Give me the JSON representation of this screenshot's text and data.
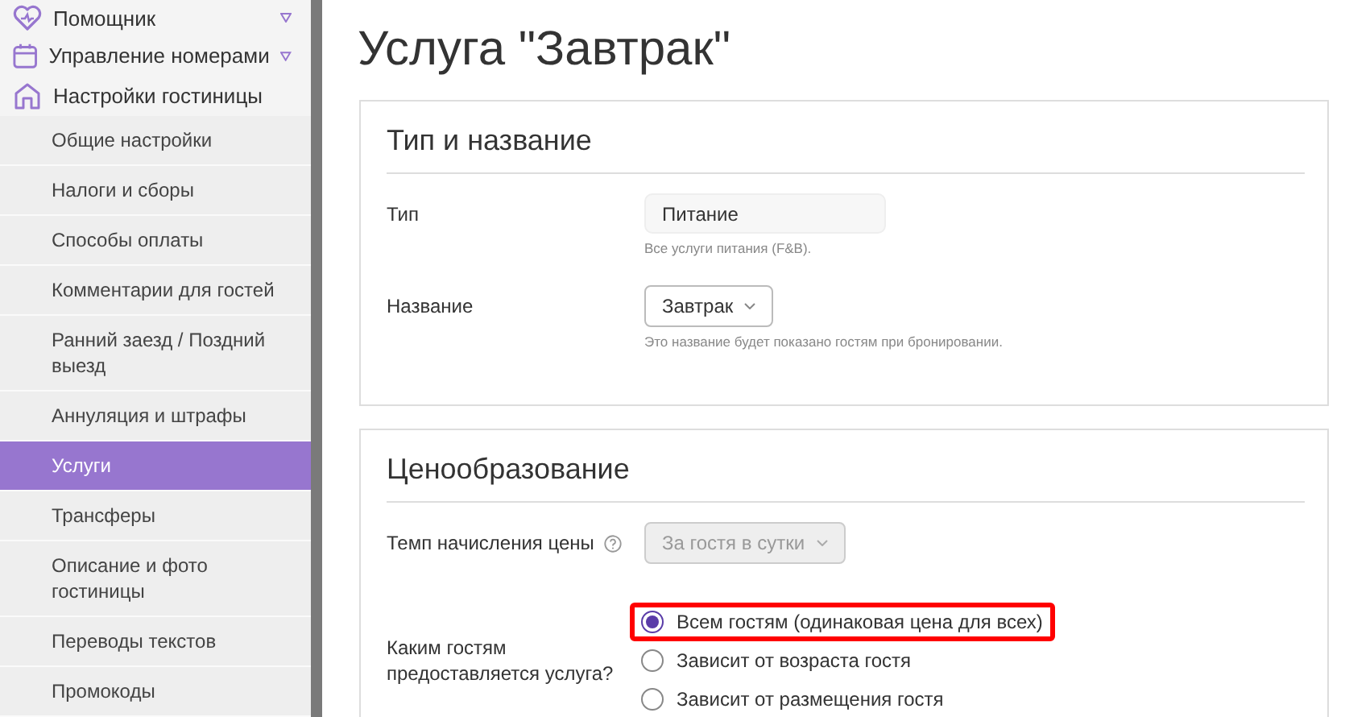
{
  "sidebar": {
    "sections": [
      {
        "label": "Помощник",
        "expandable": true
      },
      {
        "label": "Управление номерами",
        "expandable": true
      },
      {
        "label": "Настройки гостиницы",
        "expandable": false
      }
    ],
    "subitems": [
      {
        "label": "Общие настройки",
        "selected": false
      },
      {
        "label": "Налоги и сборы",
        "selected": false
      },
      {
        "label": "Способы оплаты",
        "selected": false
      },
      {
        "label": "Комментарии для гостей",
        "selected": false
      },
      {
        "label": "Ранний заезд / Поздний выезд",
        "selected": false
      },
      {
        "label": "Аннуляция и штрафы",
        "selected": false
      },
      {
        "label": "Услуги",
        "selected": true
      },
      {
        "label": "Трансферы",
        "selected": false
      },
      {
        "label": "Описание и фото гостиницы",
        "selected": false
      },
      {
        "label": "Переводы текстов",
        "selected": false
      },
      {
        "label": "Промокоды",
        "selected": false
      }
    ]
  },
  "page": {
    "title": "Услуга \"Завтрак\""
  },
  "cards": [
    {
      "title": "Тип и название",
      "rows": [
        {
          "label": "Тип",
          "kind": "text",
          "value": "Питание",
          "hint": "Все услуги питания (F&B)."
        },
        {
          "label": "Название",
          "kind": "select",
          "value": "Завтрак",
          "disabled": false,
          "hint": "Это название будет показано гостям при бронировании."
        }
      ]
    },
    {
      "title": "Ценообразование",
      "rows": [
        {
          "label": "Темп начисления цены",
          "help": true,
          "kind": "select",
          "value": "За гостя в сутки",
          "disabled": true
        },
        {
          "label": "Каким гостям предоставляется услуга?",
          "kind": "radio",
          "options": [
            {
              "label": "Всем гостям (одинаковая цена для всех)",
              "selected": true,
              "highlighted": true
            },
            {
              "label": "Зависит от возраста гостя",
              "selected": false,
              "highlighted": false
            },
            {
              "label": "Зависит от размещения гостя",
              "selected": false,
              "highlighted": false
            }
          ]
        }
      ]
    }
  ]
}
